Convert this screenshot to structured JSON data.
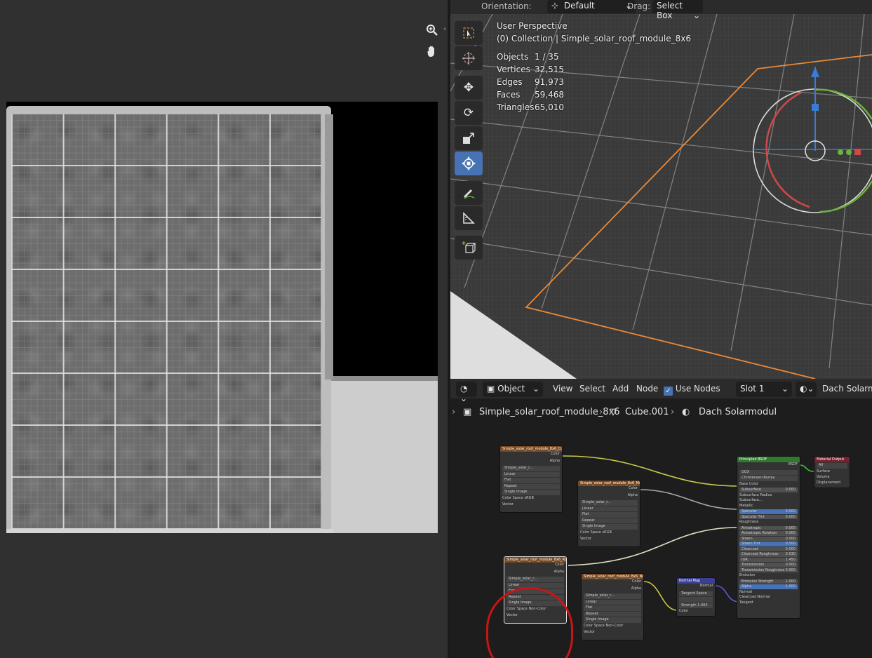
{
  "image_editor": {
    "zoom_icon": "zoom-icon",
    "pan_icon": "hand-icon",
    "collapse_icon": "chevron-left-icon"
  },
  "viewport": {
    "header": {
      "orientation_label": "Orientation:",
      "orientation_value": "Default",
      "drag_label": "Drag:",
      "drag_value": "Select Box"
    },
    "overlay": {
      "view_name": "User Perspective",
      "collection": "(0) Collection | Simple_solar_roof_module_8x6",
      "stats": [
        {
          "key": "Objects",
          "value": "1 / 35"
        },
        {
          "key": "Vertices",
          "value": "32,515"
        },
        {
          "key": "Edges",
          "value": "91,973"
        },
        {
          "key": "Faces",
          "value": "59,468"
        },
        {
          "key": "Triangles",
          "value": "65,010"
        }
      ]
    },
    "tools": [
      "select-box-icon",
      "cursor-icon",
      "move-icon",
      "rotate-icon",
      "scale-icon",
      "transform-icon",
      "annotate-icon",
      "measure-icon",
      "add-cube-icon"
    ],
    "colors": {
      "selection_outline": "#e8893a",
      "active_tool": "#4772b3"
    }
  },
  "node_editor": {
    "header": {
      "mode": "Object",
      "menu": [
        "View",
        "Select",
        "Add",
        "Node"
      ],
      "use_nodes_label": "Use Nodes",
      "use_nodes_checked": true,
      "slot": "Slot 1",
      "material": "Dach Solarmo"
    },
    "breadcrumb": {
      "object": "Simple_solar_roof_module_8x6",
      "mesh": "Cube.001",
      "material": "Dach Solarmodul"
    },
    "tex_nodes": [
      {
        "title": "Simple_solar_roof_module_8x6_Col",
        "image": "Simple_solar_r...",
        "interp": "Linear",
        "proj": "Flat",
        "ext": "Repeat",
        "src": "Single Image",
        "cs_label": "Color Space",
        "cs": "sRGB",
        "vec": "Vector",
        "out_color": "Color",
        "out_alpha": "Alpha"
      },
      {
        "title": "Simple_solar_roof_module_8x6_Met",
        "image": "Simple_solar_r...",
        "interp": "Linear",
        "proj": "Flat",
        "ext": "Repeat",
        "src": "Single Image",
        "cs_label": "Color Space",
        "cs": "sRGB",
        "vec": "Vector",
        "out_color": "Color",
        "out_alpha": "Alpha"
      },
      {
        "title": "Simple_solar_roof_module_8x6_Ro",
        "image": "Simple_solar_r...",
        "interp": "Linear",
        "proj": "Flat",
        "ext": "Repeat",
        "src": "Single Image",
        "cs_label": "Color Space",
        "cs": "Non-Color",
        "vec": "Vector",
        "out_color": "Color",
        "out_alpha": "Alpha"
      },
      {
        "title": "Simple_solar_roof_module_8x6_No",
        "image": "Simple_solar_r...",
        "interp": "Linear",
        "proj": "Flat",
        "ext": "Repeat",
        "src": "Single Image",
        "cs_label": "Color Space",
        "cs": "Non-Color",
        "vec": "Vector",
        "out_color": "Color",
        "out_alpha": "Alpha"
      }
    ],
    "bsdf": {
      "title": "Principled BSDF",
      "out": "BSDF",
      "dist": "GGX",
      "sss_method": "Christensen-Burley",
      "rows": [
        {
          "label": "Base Color",
          "value": ""
        },
        {
          "label": "Subsurface",
          "value": "0.000"
        },
        {
          "label": "Subsurface Radius",
          "value": ""
        },
        {
          "label": "Subsurface...",
          "value": ""
        },
        {
          "label": "Metallic",
          "value": ""
        },
        {
          "label": "Specular",
          "value": "0.500"
        },
        {
          "label": "Specular Tint",
          "value": "0.000"
        },
        {
          "label": "Roughness",
          "value": ""
        },
        {
          "label": "Anisotropic",
          "value": "0.000"
        },
        {
          "label": "Anisotropic Rotation",
          "value": "0.000"
        },
        {
          "label": "Sheen",
          "value": "0.000"
        },
        {
          "label": "Sheen Tint",
          "value": "0.500"
        },
        {
          "label": "Clearcoat",
          "value": "0.000"
        },
        {
          "label": "Clearcoat Roughness",
          "value": "0.030"
        },
        {
          "label": "IOR",
          "value": "1.450"
        },
        {
          "label": "Transmission",
          "value": "0.000"
        },
        {
          "label": "Transmission Roughness",
          "value": "0.000"
        },
        {
          "label": "Emission",
          "value": ""
        },
        {
          "label": "Emission Strength",
          "value": "1.000"
        },
        {
          "label": "Alpha",
          "value": "1.000"
        },
        {
          "label": "Normal",
          "value": ""
        },
        {
          "label": "Clearcoat Normal",
          "value": ""
        },
        {
          "label": "Tangent",
          "value": ""
        }
      ]
    },
    "output_node": {
      "title": "Material Output",
      "target": "All",
      "sockets": [
        "Surface",
        "Volume",
        "Displacement"
      ]
    },
    "normal_map": {
      "title": "Normal Map",
      "out": "Normal",
      "space": "Tangent Space",
      "strength_label": "Strength",
      "strength": "1.000",
      "color": "Color"
    }
  }
}
